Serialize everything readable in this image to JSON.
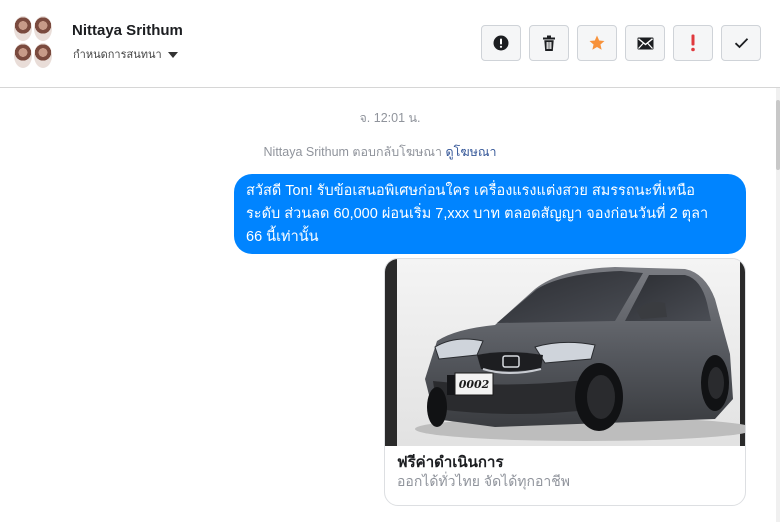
{
  "header": {
    "contact_name": "Nittaya Srithum",
    "conversation_settings": "กำหนดการสนทนา",
    "actions": [
      {
        "name": "report-spam-button",
        "icon": "exclamation-circle-icon"
      },
      {
        "name": "delete-button",
        "icon": "trash-icon"
      },
      {
        "name": "star-button",
        "icon": "star-icon",
        "color": "#f7923b"
      },
      {
        "name": "mark-unread-button",
        "icon": "envelope-icon"
      },
      {
        "name": "mark-important-button",
        "icon": "exclamation-icon",
        "color": "#e0393e"
      },
      {
        "name": "mark-done-button",
        "icon": "check-icon"
      }
    ]
  },
  "thread": {
    "timestamp": "จ. 12:01 น.",
    "ad_reply_prefix": "Nittaya Srithum ตอบกลับโฆษณา",
    "ad_reply_link": "ดูโฆษณา",
    "message_lines": [
      "สวัสดี Ton! รับข้อเสนอพิเศษก่อนใคร เครื่องแรงแต่งสวย สมรรถนะที่เหนือ",
      "ระดับ ส่วนลด 60,000 ผ่อนเริ่ม 7,xxx บาท ตลอดสัญญา จองก่อนวันที่ 2 ตุลา",
      "66 นี้เท่านั้น"
    ],
    "card": {
      "plate": "0002",
      "title": "ฟรีค่าดำเนินการ",
      "subtitle": "ออกได้ทั่วไทย จัดได้ทุกอาชีพ"
    }
  },
  "colors": {
    "bubble": "#0084ff",
    "link": "#365899",
    "muted": "#90949c"
  }
}
